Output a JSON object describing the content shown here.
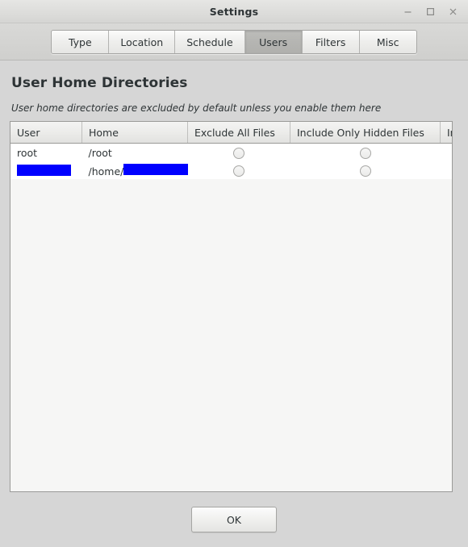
{
  "window": {
    "title": "Settings",
    "controls": [
      {
        "name": "minimize",
        "glyph": "minimize-icon"
      },
      {
        "name": "maximize",
        "glyph": "maximize-icon"
      },
      {
        "name": "close",
        "glyph": "close-icon"
      }
    ]
  },
  "tabs": [
    {
      "label": "Type",
      "active": false
    },
    {
      "label": "Location",
      "active": false
    },
    {
      "label": "Schedule",
      "active": false
    },
    {
      "label": "Users",
      "active": true
    },
    {
      "label": "Filters",
      "active": false
    },
    {
      "label": "Misc",
      "active": false
    }
  ],
  "main": {
    "title": "User Home Directories",
    "subtitle": "User home directories are excluded by default unless you enable them here"
  },
  "table": {
    "columns": [
      "User",
      "Home",
      "Exclude All Files",
      "Include Only Hidden Files",
      "Include All Files"
    ],
    "rows": [
      {
        "user": "root",
        "user_redacted": false,
        "home": "/root",
        "home_prefix": "/root",
        "home_redacted": false,
        "exclude_all_files": false,
        "include_only_hidden_files": false,
        "include_all_files": true
      },
      {
        "user": "",
        "user_redacted": true,
        "home": "/home/",
        "home_prefix": "/home/",
        "home_redacted": true,
        "exclude_all_files": false,
        "include_only_hidden_files": false,
        "include_all_files": true
      }
    ]
  },
  "footer": {
    "ok_label": "OK"
  },
  "colors": {
    "window_bg": "#d6d6d6",
    "accent_radio": "#4a90b4",
    "redaction": "#0000ff",
    "text": "#2e3436",
    "table_bg": "#ffffff"
  }
}
